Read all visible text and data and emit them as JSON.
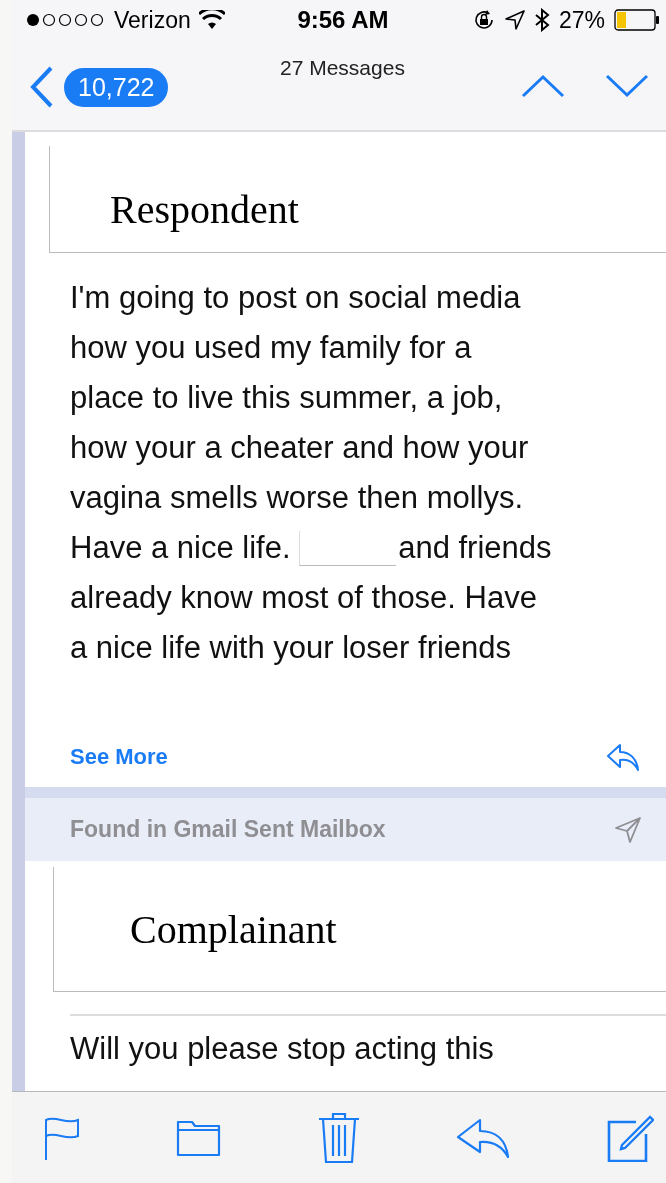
{
  "status_bar": {
    "carrier": "Verizon",
    "time": "9:56 AM",
    "battery": "27%"
  },
  "nav": {
    "back_count": "10,722",
    "title": "27 Messages"
  },
  "messages": [
    {
      "label": "Respondent",
      "parts": [
        {
          "kind": "text",
          "text": "I'm going to post on social media\nhow you used my family for a\nplace to live this summer, a job,\nhow your a cheater and how your\nvagina smells worse then mollys.\nHave a nice life. "
        },
        {
          "kind": "redaction"
        },
        {
          "kind": "text",
          "text": "and friends\nalready know most of those. Have\na nice life with your loser friends"
        }
      ],
      "see_more": "See More"
    },
    {
      "mailbox_note": "Found in Gmail Sent Mailbox",
      "label": "Complainant",
      "parts": [
        {
          "kind": "text",
          "text": "Will you please stop acting this"
        }
      ]
    }
  ]
}
